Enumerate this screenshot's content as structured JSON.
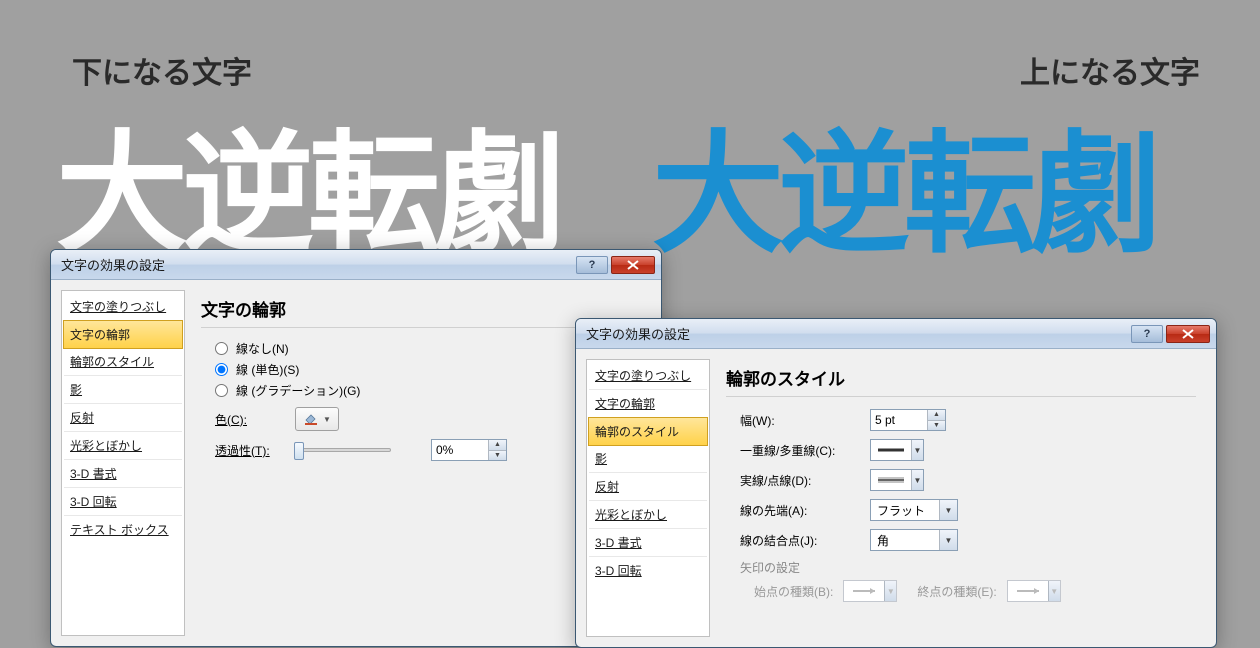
{
  "header": {
    "left_label": "下になる文字",
    "right_label": "上になる文字",
    "big_white": "大逆転劇",
    "big_blue": "大逆転劇"
  },
  "dialog1": {
    "title": "文字の効果の設定",
    "sidebar": [
      "文字の塗りつぶし",
      "文字の輪郭",
      "輪郭のスタイル",
      "影",
      "反射",
      "光彩とぼかし",
      "3-D 書式",
      "3-D 回転",
      "テキスト ボックス"
    ],
    "active_index": 1,
    "panel_title": "文字の輪郭",
    "radios": [
      {
        "label": "線なし(N)",
        "checked": false
      },
      {
        "label": "線 (単色)(S)",
        "checked": true
      },
      {
        "label": "線 (グラデーション)(G)",
        "checked": false
      }
    ],
    "color_label": "色(C):",
    "transparency_label": "透過性(T):",
    "transparency_value": "0%"
  },
  "dialog2": {
    "title": "文字の効果の設定",
    "sidebar": [
      "文字の塗りつぶし",
      "文字の輪郭",
      "輪郭のスタイル",
      "影",
      "反射",
      "光彩とぼかし",
      "3-D 書式",
      "3-D 回転"
    ],
    "active_index": 2,
    "panel_title": "輪郭のスタイル",
    "width_label": "幅(W):",
    "width_value": "5 pt",
    "compound_label": "一重線/多重線(C):",
    "dash_label": "実線/点線(D):",
    "cap_label": "線の先端(A):",
    "cap_value": "フラット",
    "join_label": "線の結合点(J):",
    "join_value": "角",
    "arrow_section": "矢印の設定",
    "start_type_label": "始点の種類(B):",
    "end_type_label": "終点の種類(E):"
  }
}
